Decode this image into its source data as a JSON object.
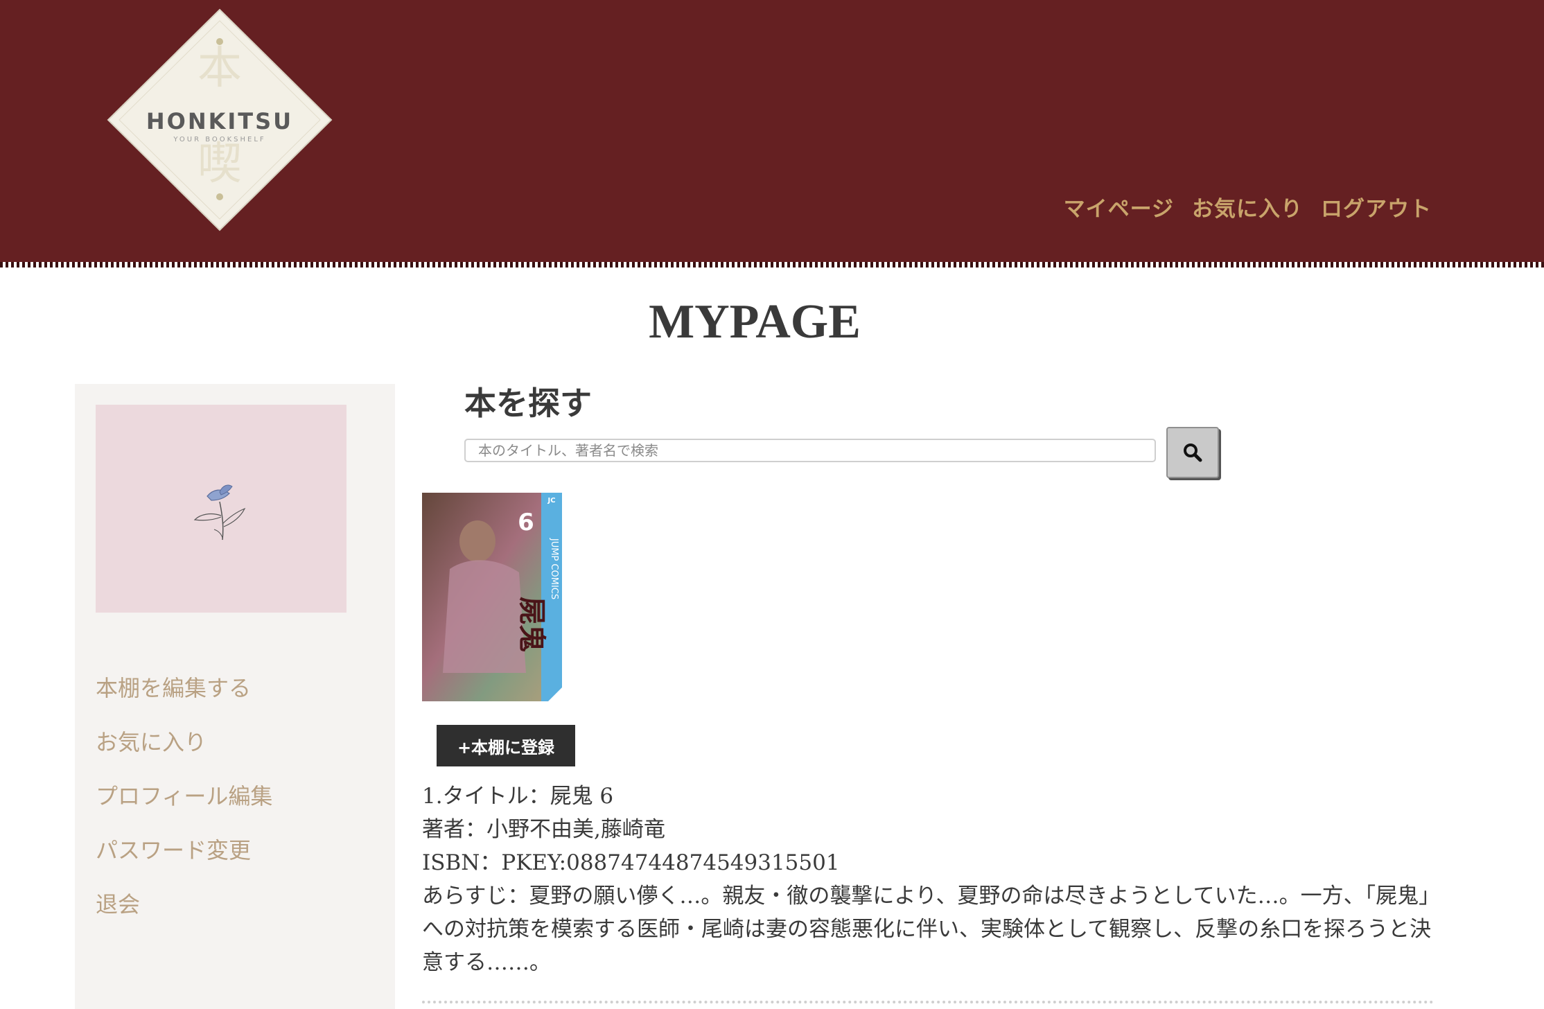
{
  "header": {
    "logo": {
      "kanji_top": "本",
      "kanji_bottom": "喫",
      "name": "HONKITSU",
      "tagline": "YOUR BOOKSHELF"
    },
    "nav": [
      "マイページ",
      "お気に入り",
      "ログアウト"
    ],
    "colors": {
      "background": "#652022",
      "nav_text": "#c9a46b"
    }
  },
  "page_title": "MYPAGE",
  "sidebar": {
    "avatar_icon": "flower-icon",
    "menu": [
      "本棚を編集する",
      "お気に入り",
      "プロフィール編集",
      "パスワード変更",
      "退会"
    ]
  },
  "search": {
    "heading": "本を探す",
    "placeholder": "本のタイトル、著者名で検索",
    "value": "",
    "button_icon": "search-icon"
  },
  "result": {
    "register_label": "+本棚に登録",
    "title_line": "1.タイトル：屍鬼 6",
    "author_line": "著者：小野不由美,藤崎竜",
    "isbn_line": "ISBN：PKEY:08874744874549315501",
    "synopsis_line": "あらすじ：夏野の願い儚く…。親友・徹の襲撃により、夏野の命は尽きようとしていた…。一方、「屍鬼」への対抗策を模索する医師・尾崎は妻の容態悪化に伴い、実験体として観察し、反撃の糸口を探ろうと決意する……。",
    "cover": {
      "volume": "6",
      "series_text": "JUMP COMICS",
      "title_kanji": "屍鬼",
      "publisher_badge": "JC"
    }
  }
}
